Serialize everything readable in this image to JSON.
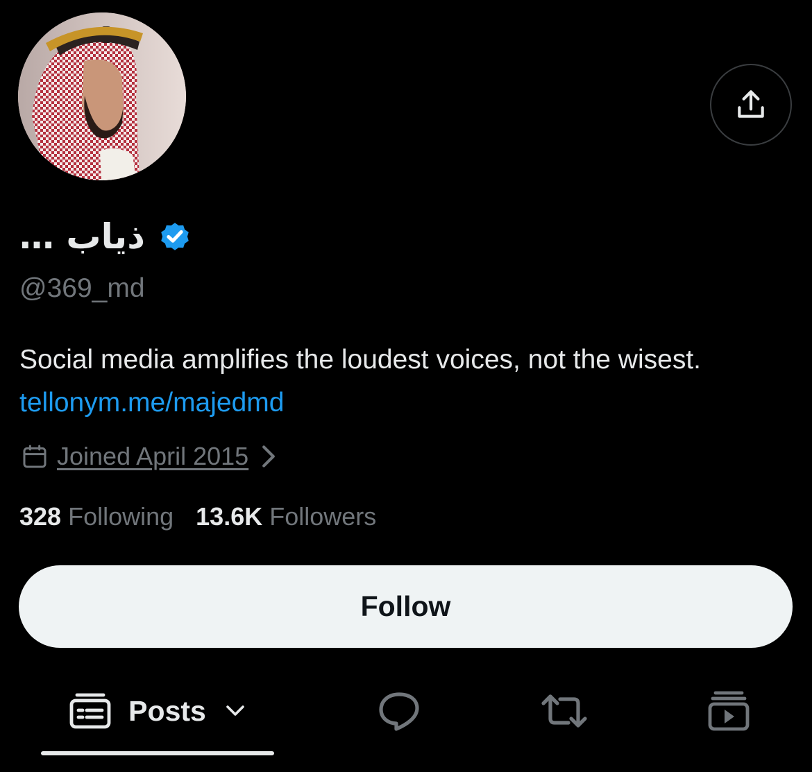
{
  "profile": {
    "display_name": "ذياب …",
    "handle": "@369_md",
    "verified": true,
    "bio_text": "Social media amplifies the loudest voices, not the wisest. ",
    "bio_link": "tellonym.me/majedmd",
    "joined": "Joined April 2015",
    "following_count": "328",
    "following_label": "Following",
    "followers_count": "13.6K",
    "followers_label": "Followers"
  },
  "actions": {
    "follow_label": "Follow"
  },
  "tabs": {
    "posts_label": "Posts"
  },
  "icons": {
    "share": "share-icon",
    "verified": "verified-badge-icon",
    "calendar": "calendar-icon",
    "posts": "posts-icon",
    "replies": "reply-bubble-icon",
    "reposts": "repost-icon",
    "media": "media-icon"
  },
  "colors": {
    "background": "#000000",
    "text": "#e7e9ea",
    "muted": "#71767b",
    "accent": "#1d9bf0",
    "button_bg": "#eff3f4"
  }
}
